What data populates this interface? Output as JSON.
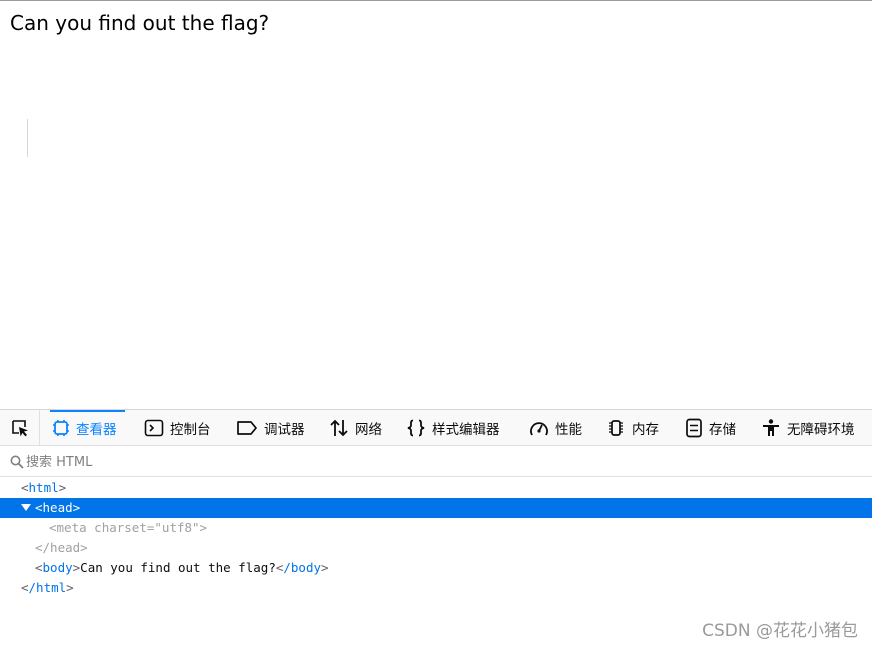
{
  "page": {
    "text": "Can you find out the flag?"
  },
  "devtools": {
    "tabs": [
      {
        "label": "查看器",
        "icon": "inspector-icon",
        "selected": true
      },
      {
        "label": "控制台",
        "icon": "console-icon",
        "selected": false
      },
      {
        "label": "调试器",
        "icon": "debugger-icon",
        "selected": false
      },
      {
        "label": "网络",
        "icon": "network-icon",
        "selected": false
      },
      {
        "label": "样式编辑器",
        "icon": "style-editor-icon",
        "selected": false
      },
      {
        "label": "性能",
        "icon": "performance-icon",
        "selected": false
      },
      {
        "label": "内存",
        "icon": "memory-icon",
        "selected": false
      },
      {
        "label": "存储",
        "icon": "storage-icon",
        "selected": false
      },
      {
        "label": "无障碍环境",
        "icon": "accessibility-icon",
        "selected": false
      }
    ],
    "search": {
      "placeholder": "搜索 HTML",
      "value": ""
    },
    "tree": {
      "html_open_tag": "html",
      "head_tag": "head",
      "meta_tag": "meta",
      "meta_attr_name": "charset",
      "meta_attr_value": "\"utf8\"",
      "head_close_tag": "/head",
      "body_tag": "body",
      "body_text": "Can you find out the flag?",
      "body_close_tag": "/body",
      "html_close_tag": "/html"
    },
    "accent_color": "#0a84ff",
    "selection_color": "#0074e8"
  },
  "watermark": "CSDN @花花小猪包"
}
